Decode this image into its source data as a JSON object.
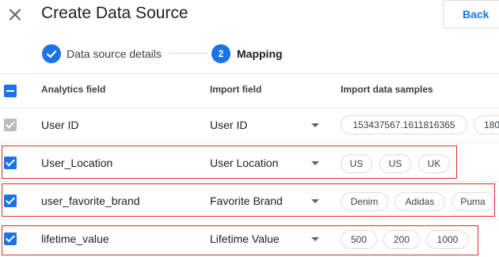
{
  "header": {
    "title": "Create Data Source",
    "back_label": "Back"
  },
  "stepper": {
    "steps": [
      {
        "number": "",
        "label": "Data source details",
        "status": "completed"
      },
      {
        "number": "2",
        "label": "Mapping",
        "status": "active"
      }
    ]
  },
  "table": {
    "columns": [
      "Analytics field",
      "Import field",
      "Import data samples"
    ],
    "rows": [
      {
        "checked": true,
        "disabled": true,
        "highlighted": false,
        "analytics_field": "User ID",
        "import_field": "User ID",
        "samples": [
          "153437567.1611816365",
          "180"
        ]
      },
      {
        "checked": true,
        "disabled": false,
        "highlighted": true,
        "analytics_field": "User_Location",
        "import_field": "User Location",
        "samples": [
          "US",
          "US",
          "UK"
        ]
      },
      {
        "checked": true,
        "disabled": false,
        "highlighted": true,
        "analytics_field": "user_favorite_brand",
        "import_field": "Favorite Brand",
        "samples": [
          "Denim",
          "Adidas",
          "Puma"
        ]
      },
      {
        "checked": true,
        "disabled": false,
        "highlighted": true,
        "analytics_field": "lifetime_value",
        "import_field": "Lifetime Value",
        "samples": [
          "500",
          "200",
          "1000"
        ]
      }
    ]
  },
  "colors": {
    "accent": "#1a73e8",
    "highlight_border": "#d93025",
    "disabled_checkbox": "#bdbdbd"
  },
  "icons": {
    "close": "close-icon",
    "check": "check-icon",
    "dropdown": "chevron-down-icon",
    "select_all": "indeterminate-icon"
  }
}
